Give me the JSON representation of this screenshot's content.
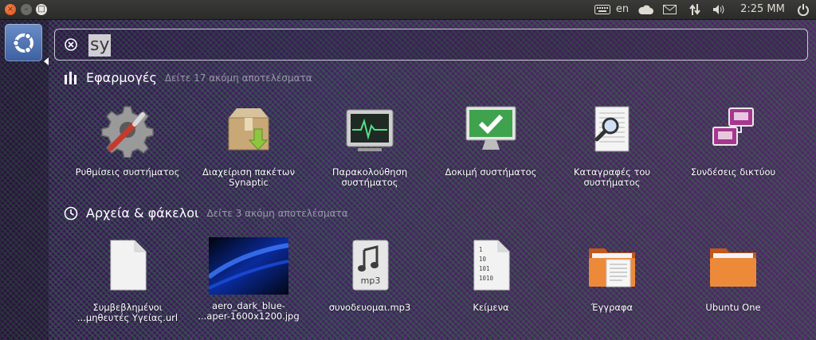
{
  "topbar": {
    "keyboard_layout": "en",
    "clock": "2:25 MM",
    "icons": [
      "keyboard-icon",
      "cloud-icon",
      "mail-icon",
      "network-icon",
      "volume-icon",
      "power-icon"
    ]
  },
  "search": {
    "query": "sy"
  },
  "categories": [
    {
      "title": "Εφαρμογές",
      "more": "Δείτε 17 ακόμη αποτελέσματα",
      "icon": "apps-icon"
    },
    {
      "title": "Αρχεία & φάκελοι",
      "more": "Δείτε 3 ακόμη αποτελέσματα",
      "icon": "recent-files-icon"
    }
  ],
  "apps": [
    {
      "line1": "Ρυθμίσεις συστήματος",
      "line2": "",
      "icon": "settings-icon"
    },
    {
      "line1": "Διαχείριση πακέτων",
      "line2": "Synaptic",
      "icon": "package-manager-icon"
    },
    {
      "line1": "Παρακολούθηση",
      "line2": "συστήματος",
      "icon": "system-monitor-icon"
    },
    {
      "line1": "Δοκιμή συστήματος",
      "line2": "",
      "icon": "system-test-icon"
    },
    {
      "line1": "Καταγραφές του",
      "line2": "συστήματος",
      "icon": "log-viewer-icon"
    },
    {
      "line1": "Συνδέσεις δικτύου",
      "line2": "",
      "icon": "network-connections-icon"
    }
  ],
  "files": [
    {
      "line1": "Συμβεβλημένοι",
      "line2": "...μηθευτές Υγείας.url",
      "icon": "document-icon"
    },
    {
      "line1": "aero_dark_blue-",
      "line2": "...aper-1600x1200.jpg",
      "icon": "image-thumbnail"
    },
    {
      "line1": "συνοδευομαι.mp3",
      "line2": "",
      "icon": "audio-file-icon"
    },
    {
      "line1": "Κείμενα",
      "line2": "",
      "icon": "binary-file-icon"
    },
    {
      "line1": "Έγγραφα",
      "line2": "",
      "icon": "documents-folder-icon"
    },
    {
      "line1": "Ubuntu One",
      "line2": "",
      "icon": "folder-icon"
    }
  ],
  "colors": {
    "accent": "#dd4814",
    "panel": "#2b2b29",
    "folder": "#e8792f"
  }
}
